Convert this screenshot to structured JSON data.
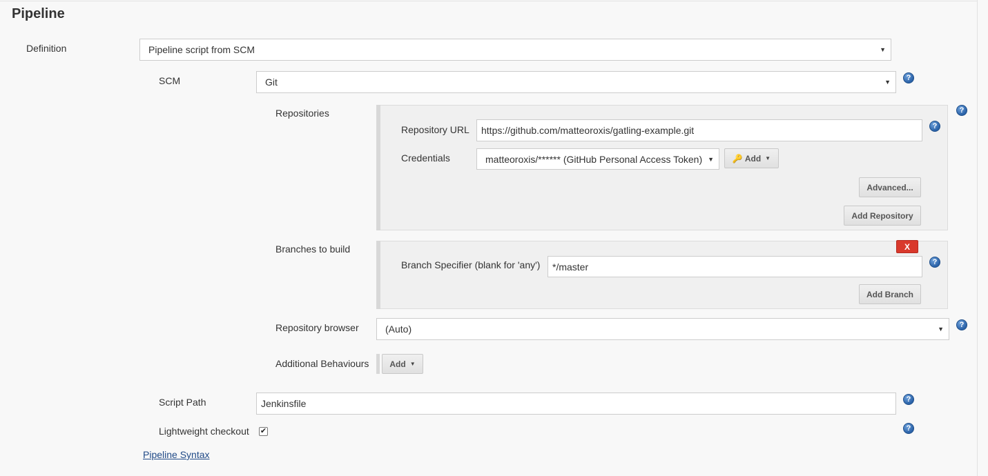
{
  "section": {
    "title": "Pipeline"
  },
  "definition": {
    "label": "Definition",
    "selected": "Pipeline script from SCM"
  },
  "scm": {
    "label": "SCM",
    "selected": "Git"
  },
  "repositories": {
    "label": "Repositories",
    "url_label": "Repository URL",
    "url_value": "https://github.com/matteoroxis/gatling-example.git",
    "credentials_label": "Credentials",
    "credentials_selected": "matteoroxis/****** (GitHub Personal Access Token)",
    "add_label": "Add",
    "advanced_label": "Advanced...",
    "add_repository_label": "Add Repository"
  },
  "branches": {
    "label": "Branches to build",
    "delete_label": "X",
    "specifier_label": "Branch Specifier (blank for 'any')",
    "specifier_value": "*/master",
    "add_branch_label": "Add Branch"
  },
  "repo_browser": {
    "label": "Repository browser",
    "selected": "(Auto)"
  },
  "additional_behaviours": {
    "label": "Additional Behaviours",
    "add_label": "Add"
  },
  "script_path": {
    "label": "Script Path",
    "value": "Jenkinsfile"
  },
  "lightweight": {
    "label": "Lightweight checkout",
    "checked": true,
    "check_glyph": "✔"
  },
  "pipeline_syntax": {
    "label": "Pipeline Syntax"
  },
  "icons": {
    "help": "?",
    "dropdown": "▼",
    "caret": "▼",
    "key": "🔑"
  },
  "colors": {
    "help_blue": "#2a62a8",
    "delete_red": "#d9392c",
    "link": "#204a87"
  }
}
